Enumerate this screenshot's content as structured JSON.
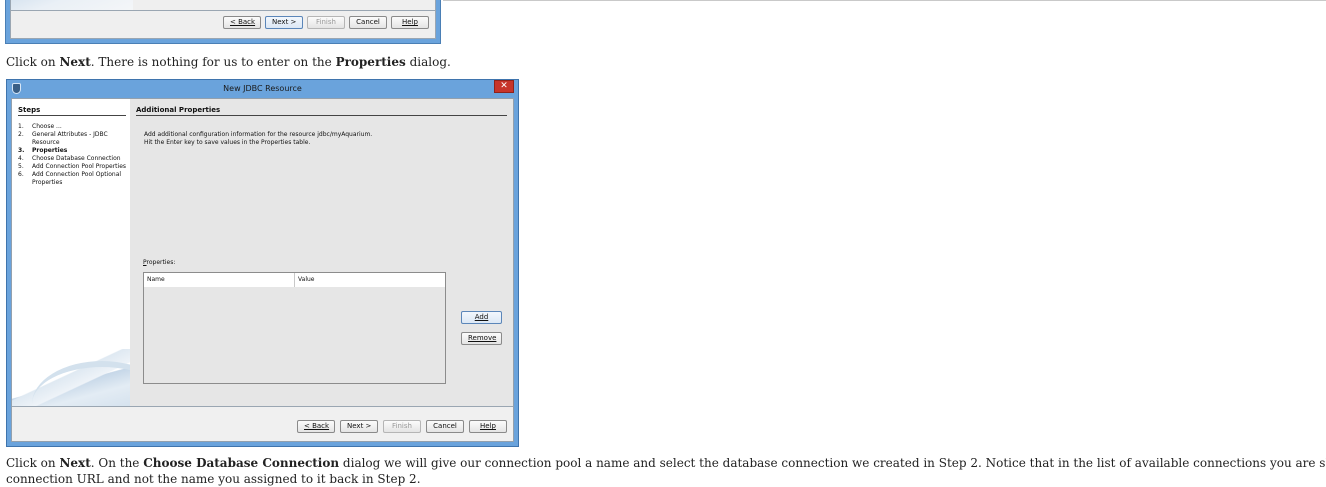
{
  "top_dialog": {
    "buttons": [
      {
        "label": "< Back",
        "state": "normal"
      },
      {
        "label": "Next >",
        "state": "default"
      },
      {
        "label": "Finish",
        "state": "disabled"
      },
      {
        "label": "Cancel",
        "state": "normal"
      },
      {
        "label": "Help",
        "state": "normal"
      }
    ]
  },
  "paragraph1": {
    "t1": "Click on ",
    "b1": "Next",
    "t2": ". There is nothing for us to enter on the ",
    "b2": "Properties",
    "t3": " dialog."
  },
  "dialog": {
    "title": "New JDBC Resource",
    "close_glyph": "✕",
    "steps_title": "Steps",
    "steps": [
      {
        "n": "1.",
        "label": "Choose ...",
        "active": false
      },
      {
        "n": "2.",
        "label": "General Attributes - JDBC Resource",
        "active": false
      },
      {
        "n": "3.",
        "label": "Properties",
        "active": true
      },
      {
        "n": "4.",
        "label": "Choose Database Connection",
        "active": false
      },
      {
        "n": "5.",
        "label": "Add Connection Pool Properties",
        "active": false
      },
      {
        "n": "6.",
        "label": "Add Connection Pool Optional Properties",
        "active": false
      }
    ],
    "section_title": "Additional Properties",
    "description_line1": "Add additional configuration information for the resource jdbc/myAquarium.",
    "description_line2": "Hit the Enter key to save values in the Properties table.",
    "properties_label_first": "P",
    "properties_label_rest": "roperties:",
    "table_headers": {
      "name": "Name",
      "value": "Value"
    },
    "add_label": "Add",
    "remove_label": "Remove",
    "footer_buttons": {
      "back": "< Back",
      "next": "Next >",
      "finish": "Finish",
      "cancel": "Cancel",
      "help": "Help"
    }
  },
  "paragraph2": {
    "t1": "Click on ",
    "b1": "Next",
    "t2": ". On the ",
    "b2": "Choose Database Connection",
    "t3": " dialog we will give our connection pool a name and select the database connection we created in Step 2. Notice that in the list of available connections you are shown the",
    "line2": "connection URL and not the name you assigned to it back in Step 2."
  },
  "colors": {
    "window_frame": "#6aa3dc",
    "close_button": "#c7342a",
    "dialog_body": "#e6e6e6"
  }
}
